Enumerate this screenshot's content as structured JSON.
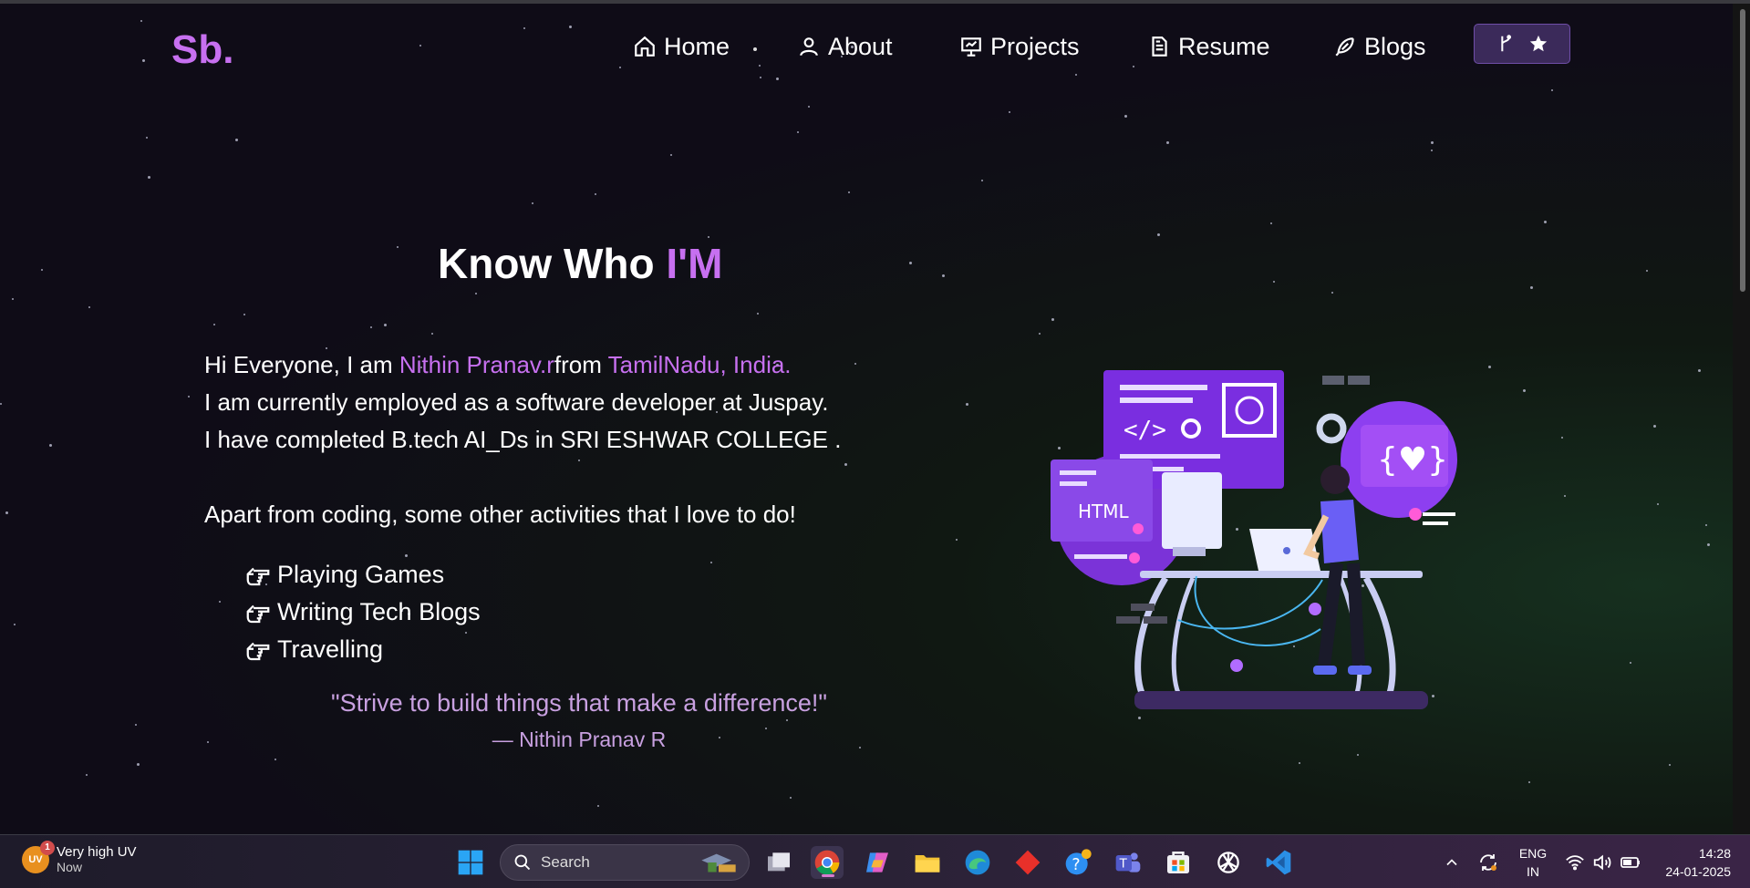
{
  "navbar": {
    "logo": "Sb.",
    "items": [
      {
        "label": "Home",
        "icon": "home-icon"
      },
      {
        "label": "About",
        "icon": "user-icon"
      },
      {
        "label": "Projects",
        "icon": "presentation-icon"
      },
      {
        "label": "Resume",
        "icon": "document-icon"
      },
      {
        "label": "Blogs",
        "icon": "feather-icon"
      }
    ],
    "fork_button": {
      "icons": [
        "git-fork-icon",
        "star-icon"
      ]
    }
  },
  "about": {
    "heading_prefix": "Know Who",
    "heading_accent": "I'M",
    "intro_prefix": "Hi Everyone, I am ",
    "name": "Nithin Pranav.r",
    "from_text": "from ",
    "location": "TamilNadu, India.",
    "line2": "I am currently employed as a software developer at Juspay.",
    "line3": "I have completed B.tech AI_Ds in SRI ESHWAR COLLEGE .",
    "activities_intro": "Apart from coding, some other activities that I love to do!",
    "hobbies": [
      "Playing Games",
      "Writing Tech Blogs",
      "Travelling"
    ],
    "quote": "\"Strive to build things that make a difference!\"",
    "quote_author": "— Nithin Pranav R"
  },
  "illustration": {
    "label": "HTML"
  },
  "taskbar": {
    "weather_badge": "UV",
    "weather_count": "1",
    "weather_title": "Very high UV",
    "weather_sub": "Now",
    "search_placeholder": "Search",
    "apps": [
      "windows-start-icon",
      "task-view-icon",
      "chrome-icon",
      "copilot-icon",
      "file-explorer-icon",
      "edge-icon",
      "git-icon",
      "help-icon",
      "teams-icon",
      "store-icon",
      "chatgpt-icon",
      "vscode-icon"
    ],
    "lang_top": "ENG",
    "lang_bottom": "IN",
    "time": "14:28",
    "date": "24-01-2025"
  },
  "colors": {
    "accent": "#c770f0",
    "quote": "#c8a0e0",
    "background": "#0f0b16"
  }
}
